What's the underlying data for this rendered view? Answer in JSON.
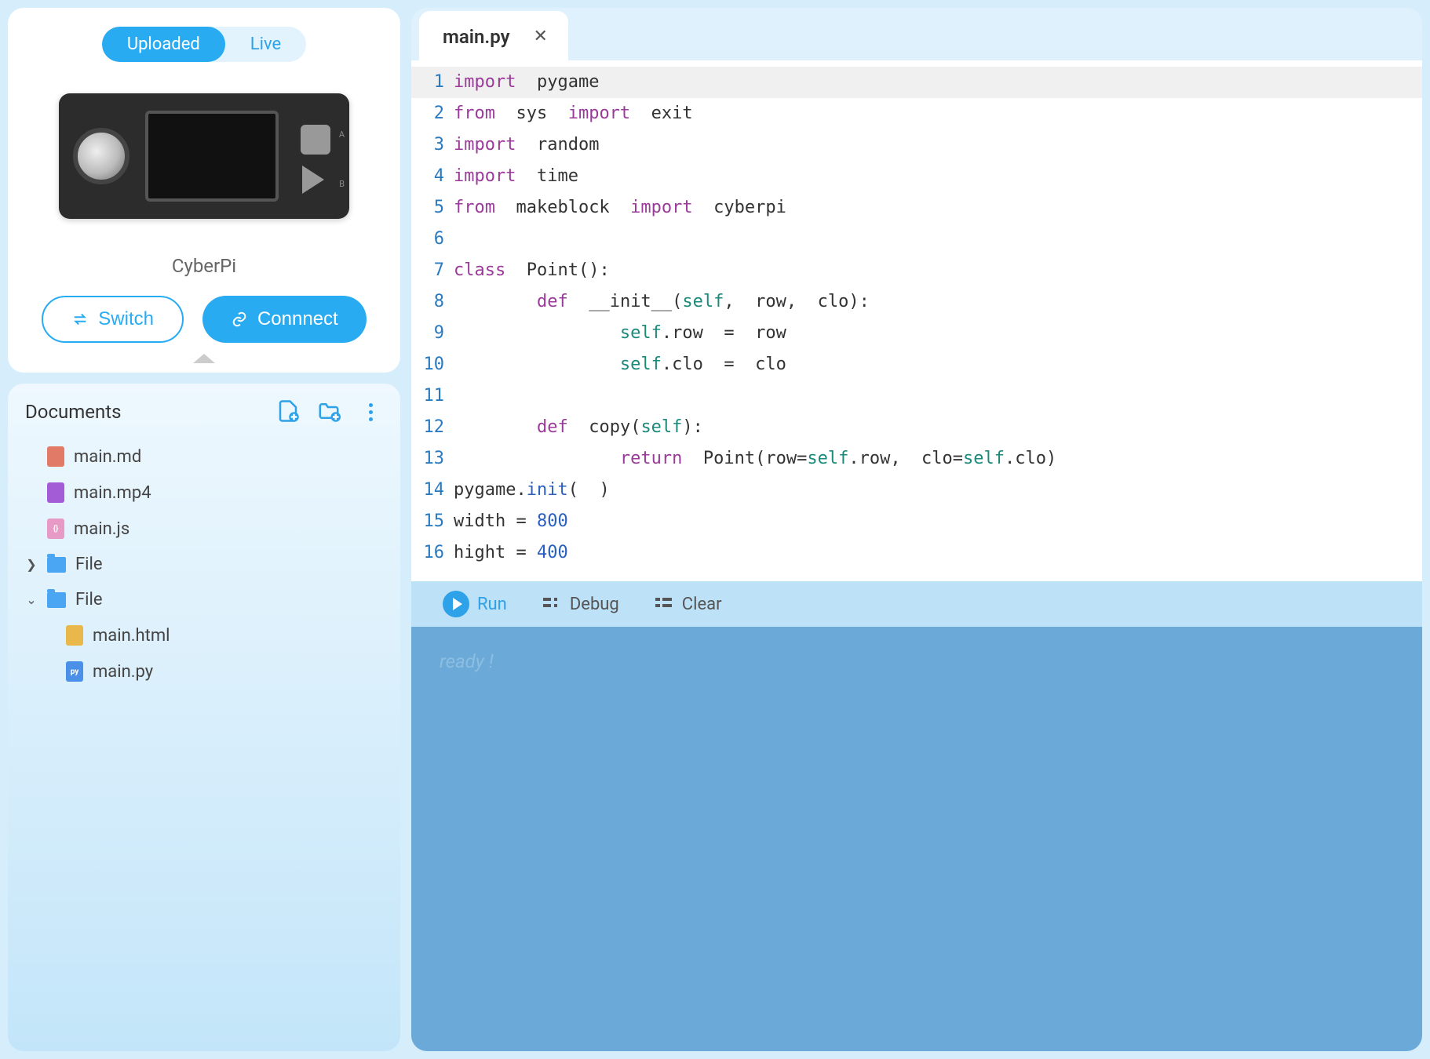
{
  "device": {
    "toggle": {
      "uploaded": "Uploaded",
      "live": "Live"
    },
    "name": "CyberPi",
    "switch_label": "Switch",
    "connect_label": "Connnect"
  },
  "docs": {
    "title": "Documents",
    "files": [
      {
        "name": "main.md",
        "type": "md"
      },
      {
        "name": "main.mp4",
        "type": "mp4"
      },
      {
        "name": "main.js",
        "type": "js"
      }
    ],
    "folder_closed": "File",
    "folder_open": "File",
    "nested": [
      {
        "name": "main.html",
        "type": "html"
      },
      {
        "name": "main.py",
        "type": "py"
      }
    ]
  },
  "editor": {
    "tab": "main.py",
    "lines": [
      [
        {
          "t": "import",
          "c": "kw"
        },
        {
          "t": "  pygame",
          "c": "idn"
        }
      ],
      [
        {
          "t": "from",
          "c": "kw"
        },
        {
          "t": "  sys  ",
          "c": "idn"
        },
        {
          "t": "import",
          "c": "kw"
        },
        {
          "t": "  exit",
          "c": "idn"
        }
      ],
      [
        {
          "t": "import",
          "c": "kw"
        },
        {
          "t": "  random",
          "c": "idn"
        }
      ],
      [
        {
          "t": "import",
          "c": "kw"
        },
        {
          "t": "  time",
          "c": "idn"
        }
      ],
      [
        {
          "t": "from",
          "c": "kw"
        },
        {
          "t": "  makeblock  ",
          "c": "idn"
        },
        {
          "t": "import",
          "c": "kw"
        },
        {
          "t": "  cyberpi",
          "c": "idn"
        }
      ],
      [
        {
          "t": "",
          "c": "idn"
        }
      ],
      [
        {
          "t": "class",
          "c": "kw"
        },
        {
          "t": "  Point():",
          "c": "idn"
        }
      ],
      [
        {
          "t": "        ",
          "c": "idn"
        },
        {
          "t": "def",
          "c": "kw"
        },
        {
          "t": "  __init__(",
          "c": "idn"
        },
        {
          "t": "self",
          "c": "prop"
        },
        {
          "t": ",  row,  clo):",
          "c": "idn"
        }
      ],
      [
        {
          "t": "                ",
          "c": "idn"
        },
        {
          "t": "self",
          "c": "prop"
        },
        {
          "t": ".row  =  row",
          "c": "idn"
        }
      ],
      [
        {
          "t": "                ",
          "c": "idn"
        },
        {
          "t": "self",
          "c": "prop"
        },
        {
          "t": ".clo  =  clo",
          "c": "idn"
        }
      ],
      [
        {
          "t": "",
          "c": "idn"
        }
      ],
      [
        {
          "t": "        ",
          "c": "idn"
        },
        {
          "t": "def",
          "c": "kw"
        },
        {
          "t": "  copy(",
          "c": "idn"
        },
        {
          "t": "self",
          "c": "prop"
        },
        {
          "t": "):",
          "c": "idn"
        }
      ],
      [
        {
          "t": "                ",
          "c": "idn"
        },
        {
          "t": "return",
          "c": "kw"
        },
        {
          "t": "  Point(row=",
          "c": "idn"
        },
        {
          "t": "self",
          "c": "prop"
        },
        {
          "t": ".row,  clo=",
          "c": "idn"
        },
        {
          "t": "self",
          "c": "prop"
        },
        {
          "t": ".clo)",
          "c": "idn"
        }
      ],
      [
        {
          "t": "pygame.",
          "c": "idn"
        },
        {
          "t": "init",
          "c": "fn"
        },
        {
          "t": "(  )",
          "c": "idn"
        }
      ],
      [
        {
          "t": "width = ",
          "c": "idn"
        },
        {
          "t": "800",
          "c": "num"
        }
      ],
      [
        {
          "t": "hight = ",
          "c": "idn"
        },
        {
          "t": "400",
          "c": "num"
        }
      ]
    ]
  },
  "toolbar": {
    "run": "Run",
    "debug": "Debug",
    "clear": "Clear"
  },
  "console": {
    "text": "ready !"
  }
}
